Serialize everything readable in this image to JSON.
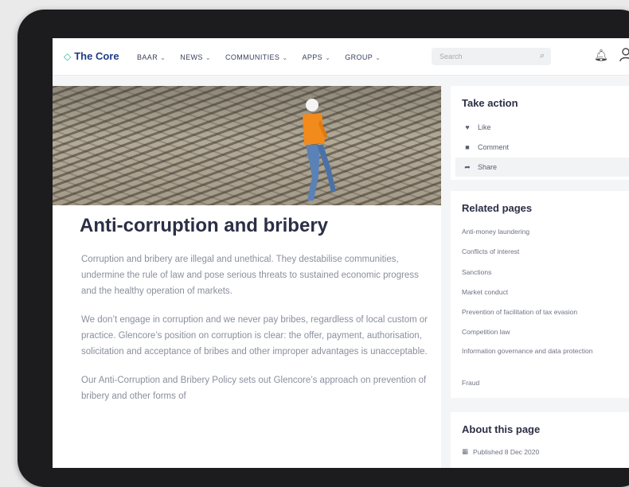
{
  "nav": {
    "logo": "The Core",
    "menu": [
      "BAAR",
      "NEWS",
      "COMMUNITIES",
      "APPS",
      "GROUP"
    ],
    "search_placeholder": "Search"
  },
  "article": {
    "title": "Anti-corruption and bribery",
    "paragraphs": [
      "Corruption and bribery are illegal and unethical. They destabilise communities, undermine the rule of law and pose serious threats to sustained economic progress and the healthy operation of markets.",
      "We don’t engage in corruption and we never pay bribes, regardless of local custom or practice. Glencore’s position on corruption is clear: the offer, payment, authorisation, solicitation and acceptance of bribes and other improper advantages is unacceptable.",
      "Our Anti-Corruption and Bribery Policy sets out Glencore’s approach on prevention of bribery and other forms of"
    ]
  },
  "take_action": {
    "title": "Take action",
    "actions": [
      "Like",
      "Comment",
      "Share"
    ]
  },
  "related": {
    "title": "Related pages",
    "items": [
      "Anti-money laundering",
      "Conflicts of interest",
      "Sanctions",
      "Market conduct",
      "Prevention of facilitation of tax evasion",
      "Competition law",
      "Information governance and data protection",
      "Fraud"
    ]
  },
  "about": {
    "title": "About this page",
    "published": "Published 8 Dec 2020"
  }
}
